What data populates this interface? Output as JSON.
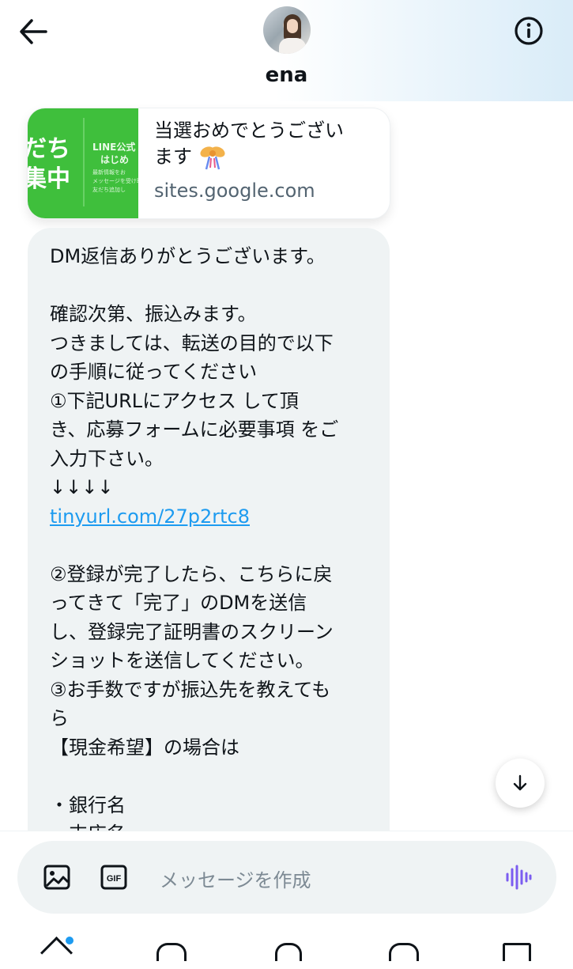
{
  "header": {
    "username": "ena",
    "back_icon": "arrow-left-icon",
    "info_icon": "info-circle-icon"
  },
  "link_preview": {
    "title_line1": "当選おめでとうござい",
    "title_line2": "ます",
    "domain": "sites.google.com",
    "thumb_big_line1": "だち",
    "thumb_big_line2": "集中",
    "thumb_small_line1": "LINE公式",
    "thumb_small_line2": "はじめ",
    "thumb_tiny_line1": "最新情報をお",
    "thumb_tiny_line2": "メッセージを受け取る",
    "thumb_tiny_line3": "友だち追加し",
    "thumb_color": "#3fbf3c"
  },
  "message": {
    "lines": [
      "DM返信ありがとうございます。",
      "",
      "確認次第、振込みます。",
      "つきましては、転送の目的で以下",
      "の手順に従ってください",
      "①下記URLにアクセス して頂",
      "き、応募フォームに必要事項 をご",
      "入力下さい。",
      "↓↓↓↓",
      "tinyurl.com/27p2rtc8",
      "",
      "②登録が完了したら、こちらに戻",
      "ってきて「完了」のDMを送信",
      "し、登録完了証明書のスクリーン",
      "ショットを送信してください。",
      "③お手数ですが振込先を教えても",
      "ら",
      "【現金希望】の場合は",
      "",
      "・銀行名",
      "・支店名"
    ],
    "link_color": "#1d9bf0",
    "bubble_color": "#eff3f4"
  },
  "composer": {
    "placeholder": "メッセージを作成",
    "image_icon": "image-icon",
    "gif_icon": "gif-icon",
    "voice_icon": "voice-wave-icon",
    "accent_color": "#7b5cf0"
  },
  "scroll_button": {
    "icon": "arrow-down-icon"
  }
}
